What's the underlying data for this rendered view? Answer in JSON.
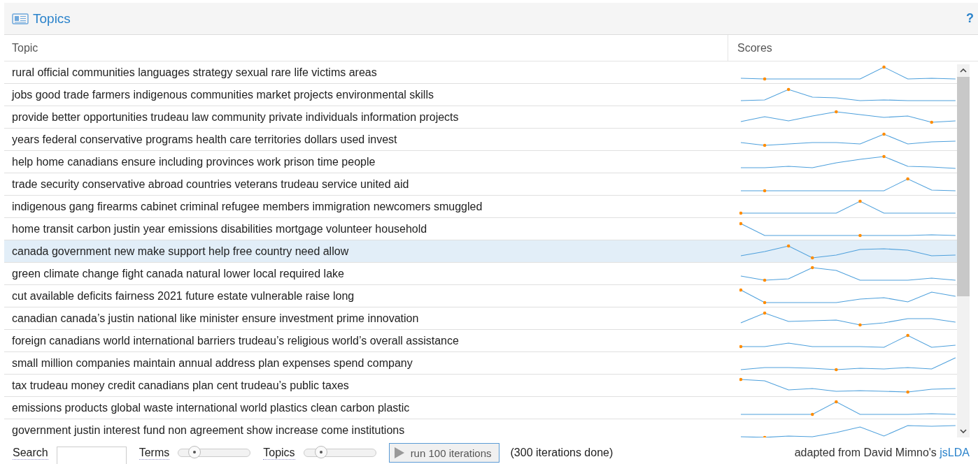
{
  "panel": {
    "title": "Topics",
    "help": "?"
  },
  "table": {
    "columns": [
      "Topic",
      "Scores"
    ],
    "rows": [
      {
        "topic": "rural official communities languages strategy sexual rare life victims areas",
        "selected": false
      },
      {
        "topic": "jobs good trade farmers indigenous communities market projects environmental skills",
        "selected": false
      },
      {
        "topic": "provide better opportunities trudeau law community private individuals information projects",
        "selected": false
      },
      {
        "topic": "years federal conservative programs health care territories dollars used invest",
        "selected": false
      },
      {
        "topic": "help home canadians ensure including provinces work prison time people",
        "selected": false
      },
      {
        "topic": "trade security conservative abroad countries veterans trudeau service united aid",
        "selected": false
      },
      {
        "topic": "indigenous gang firearms cabinet criminal refugee members immigration newcomers smuggled",
        "selected": false
      },
      {
        "topic": "home transit carbon justin year emissions disabilities mortgage volunteer household",
        "selected": false
      },
      {
        "topic": "canada government new make support help free country need allow",
        "selected": true
      },
      {
        "topic": "green climate change fight canada natural lower local required lake",
        "selected": false
      },
      {
        "topic": "cut available deficits fairness 2021 future estate vulnerable raise long",
        "selected": false
      },
      {
        "topic": "canadian canada’s justin national like minister ensure investment prime innovation",
        "selected": false
      },
      {
        "topic": "foreign canadians world international barriers trudeau’s religious world’s overall assistance",
        "selected": false
      },
      {
        "topic": "small million companies maintain annual address plan expenses spend company",
        "selected": false
      },
      {
        "topic": "tax trudeau money credit canadians plan cent trudeau’s public taxes",
        "selected": false
      },
      {
        "topic": "emissions products global waste international world plastics clean carbon plastic",
        "selected": false
      },
      {
        "topic": "government justin interest fund non agreement show increase come institutions",
        "selected": false
      }
    ]
  },
  "footer": {
    "search_label": "Search",
    "sliders": [
      {
        "label": "Terms",
        "level": 0.15
      },
      {
        "label": "Topics",
        "level": 0.17
      }
    ],
    "run_button": "run 100 iterations",
    "status": "(300 iterations done)",
    "credit": "adapted from David Mimno's ",
    "credit_link": "jsLDA"
  }
}
